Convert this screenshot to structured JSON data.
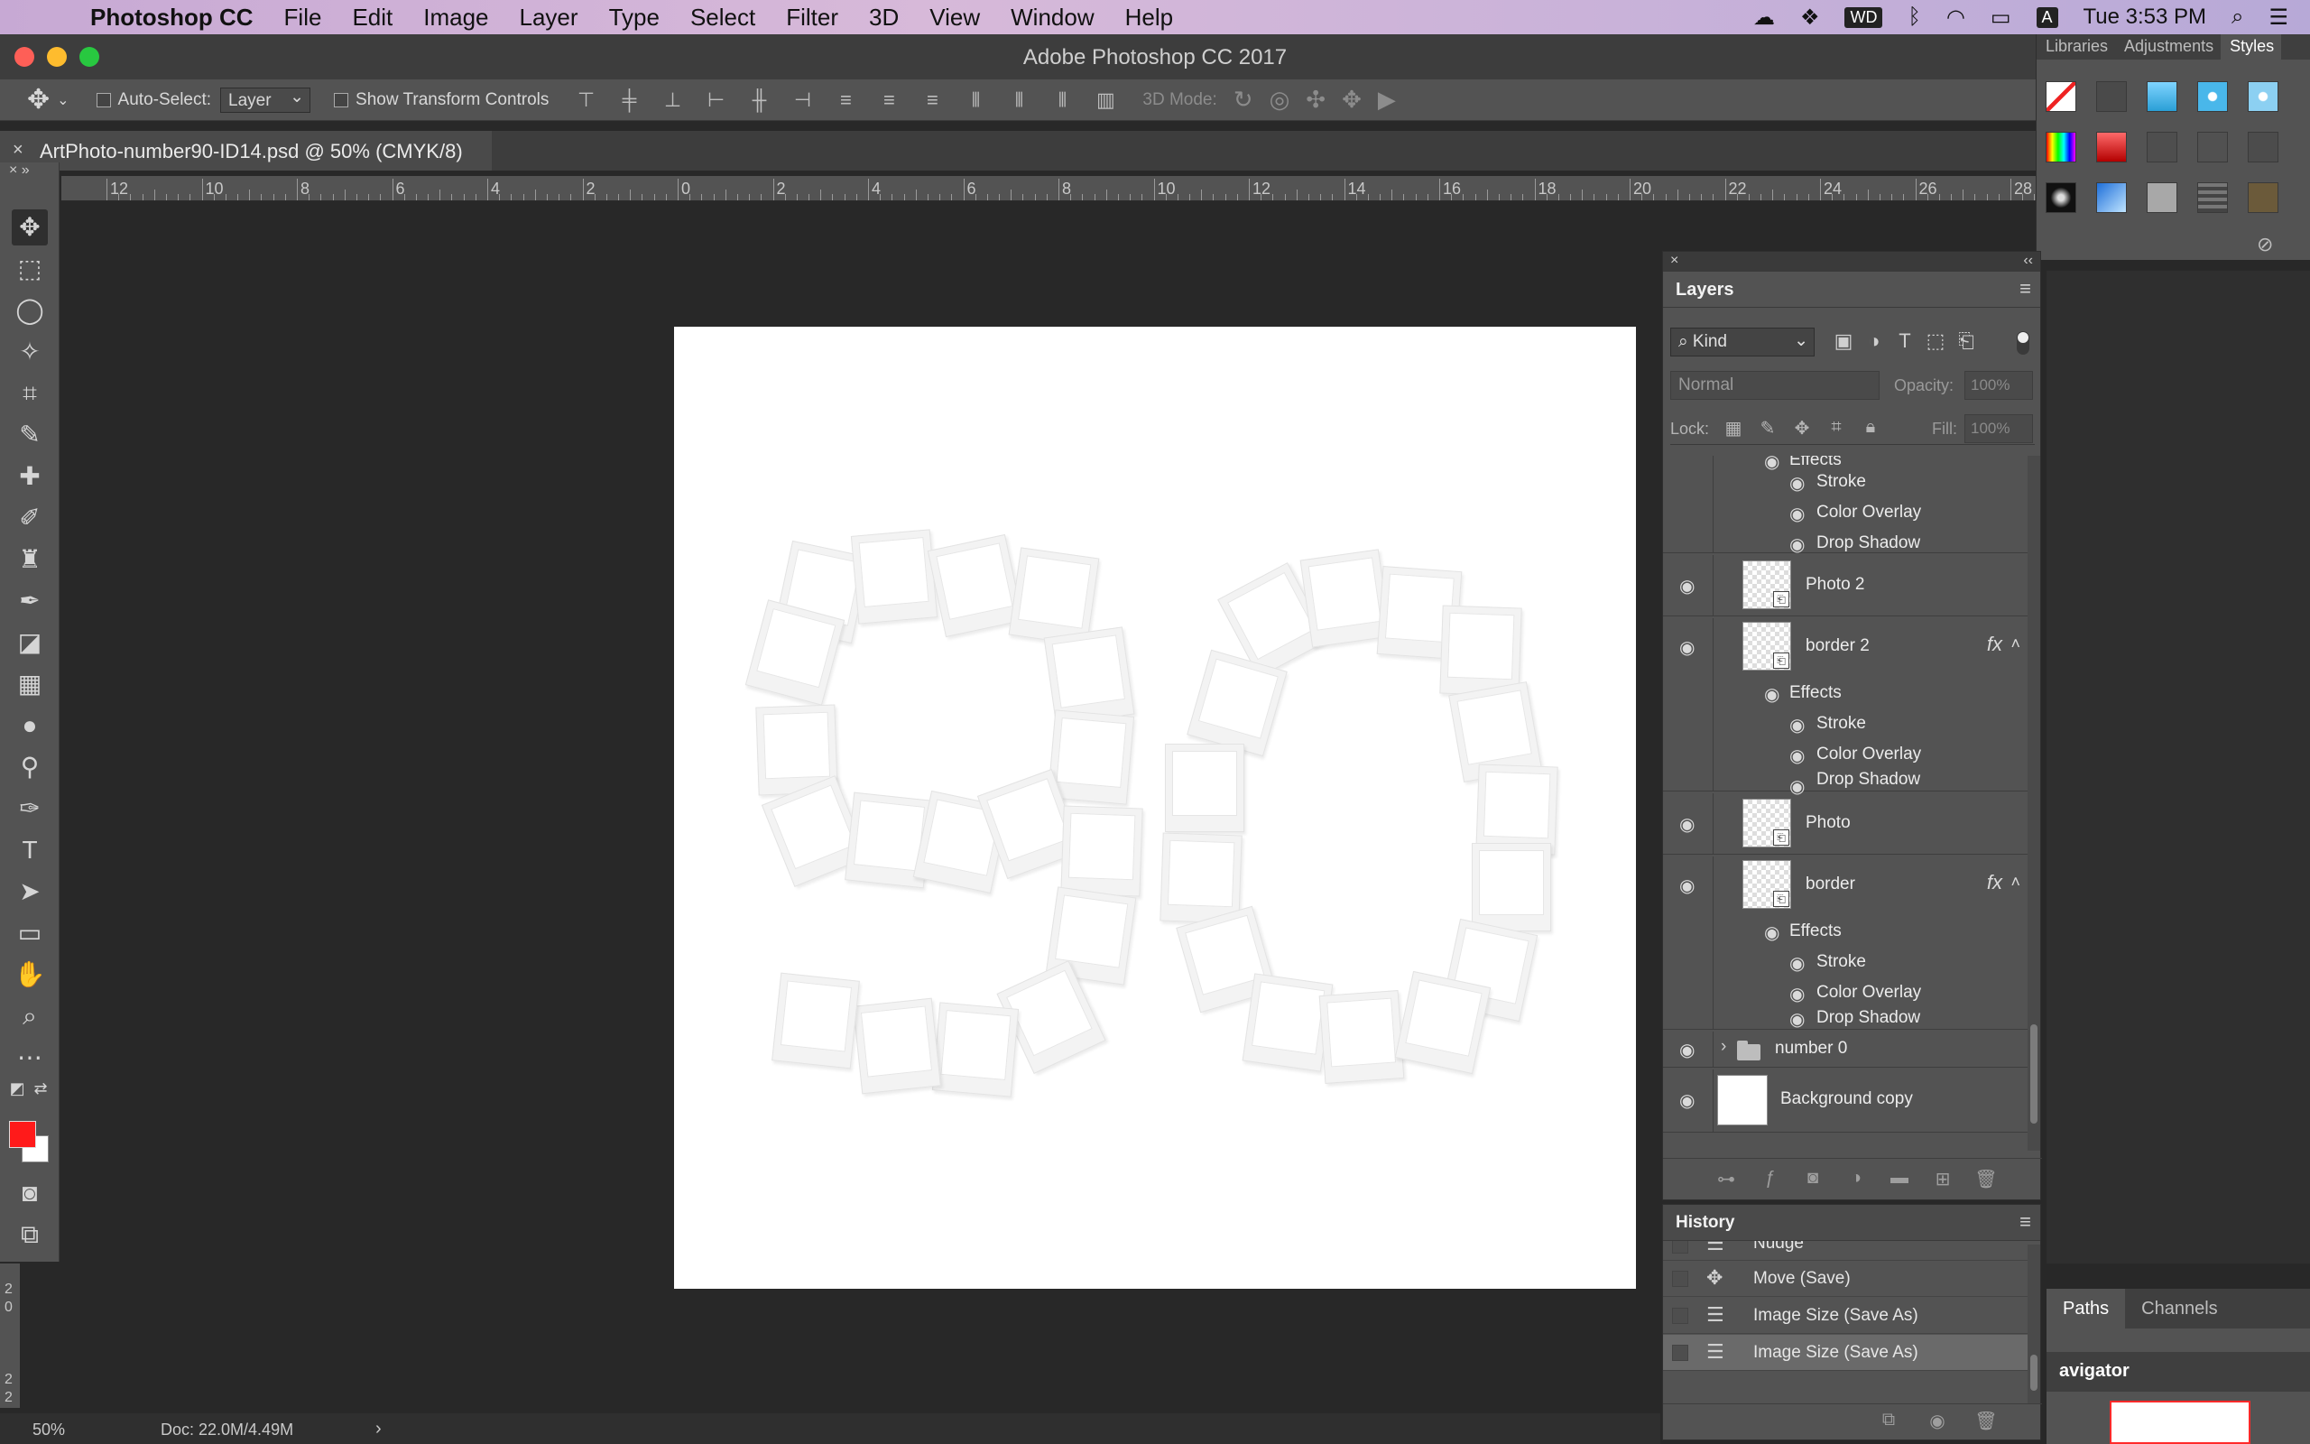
{
  "menubar": {
    "app_name": "Photoshop CC",
    "items": [
      "File",
      "Edit",
      "Image",
      "Layer",
      "Type",
      "Select",
      "Filter",
      "3D",
      "View",
      "Window",
      "Help"
    ],
    "status_icons": [
      "creative-cloud-icon",
      "dropbox-icon",
      "wd-drive-icon",
      "bluetooth-icon",
      "wifi-icon",
      "battery-icon",
      "input-source-icon",
      "spotlight-icon",
      "notification-center-icon"
    ],
    "wd_label": "WD",
    "input_label": "A",
    "clock": "Tue 3:53 PM"
  },
  "window": {
    "title": "Adobe Photoshop CC 2017",
    "traffic_colors": [
      "#fe5f57",
      "#febc2e",
      "#28c840"
    ]
  },
  "options_bar": {
    "auto_select_label": "Auto-Select:",
    "auto_select_value": "Layer",
    "show_transform_label": "Show Transform Controls",
    "mode_3d_label": "3D Mode:"
  },
  "document": {
    "tab_title": "ArtPhoto-number90-ID14.psd @ 50% (CMYK/8)"
  },
  "ruler": {
    "labels": [
      "12",
      "10",
      "8",
      "6",
      "4",
      "2",
      "0",
      "2",
      "4",
      "6",
      "8",
      "10",
      "12",
      "14",
      "16",
      "18",
      "20",
      "22",
      "24",
      "26",
      "28"
    ]
  },
  "vertical_ruler": {
    "labels": [
      "2",
      "0",
      "2",
      "2"
    ]
  },
  "tools": {
    "foreground_color": "#ff1a1a",
    "background_color": "#ffffff"
  },
  "status_bar": {
    "zoom": "50%",
    "doc_info": "Doc: 22.0M/4.49M"
  },
  "styles_panel": {
    "tabs": [
      "Libraries",
      "Adjustments",
      "Styles"
    ],
    "active_tab": "Styles"
  },
  "right_column": {
    "tabs": [
      "Paths",
      "Channels"
    ],
    "navigator_label": "avigator"
  },
  "layers_panel": {
    "title": "Layers",
    "filter_kind": "Kind",
    "blend_mode": "Normal",
    "opacity_label": "Opacity:",
    "opacity_value": "100%",
    "lock_label": "Lock:",
    "fill_label": "Fill:",
    "fill_value": "100%",
    "effects_label": "Effects",
    "effects_top": [
      "Stroke",
      "Color Overlay",
      "Drop Shadow"
    ],
    "layer_photo2": "Photo 2",
    "layer_border2": "border 2",
    "effects_border2": [
      "Stroke",
      "Color Overlay",
      "Drop Shadow"
    ],
    "layer_photo": "Photo",
    "layer_border": "border",
    "effects_border": [
      "Stroke",
      "Color Overlay",
      "Drop Shadow"
    ],
    "group_number0": "number 0",
    "layer_background_copy": "Background copy",
    "fx_label": "fx"
  },
  "history_panel": {
    "title": "History",
    "items": [
      "Nudge",
      "Move (Save)",
      "Image Size (Save As)",
      "Image Size (Save As)"
    ]
  }
}
